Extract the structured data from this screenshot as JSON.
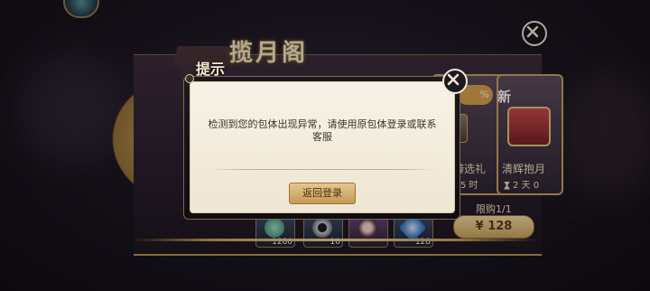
{
  "header": {
    "title": "揽月阁"
  },
  "cards": [
    {
      "badge": "%",
      "label": "臻选礼",
      "time": "5 时"
    },
    {
      "badge": "新",
      "label": "清辉抱月",
      "time": "2 天 0"
    }
  ],
  "items": [
    {
      "count": "1280",
      "icon": "jade-lotus-icon"
    },
    {
      "count": "10",
      "icon": "silver-ring-icon"
    },
    {
      "count": "",
      "icon": "character-portrait-icon"
    },
    {
      "count": "128",
      "icon": "blue-crystal-icon"
    }
  ],
  "purchase": {
    "limit": "限购1/1",
    "price": "¥ 128"
  },
  "dialog": {
    "title": "提示",
    "message": "检测到您的包体出现异常，请使用原包体登录或联系客服",
    "button": "返回登录"
  },
  "icons": {
    "close": "close-icon"
  }
}
